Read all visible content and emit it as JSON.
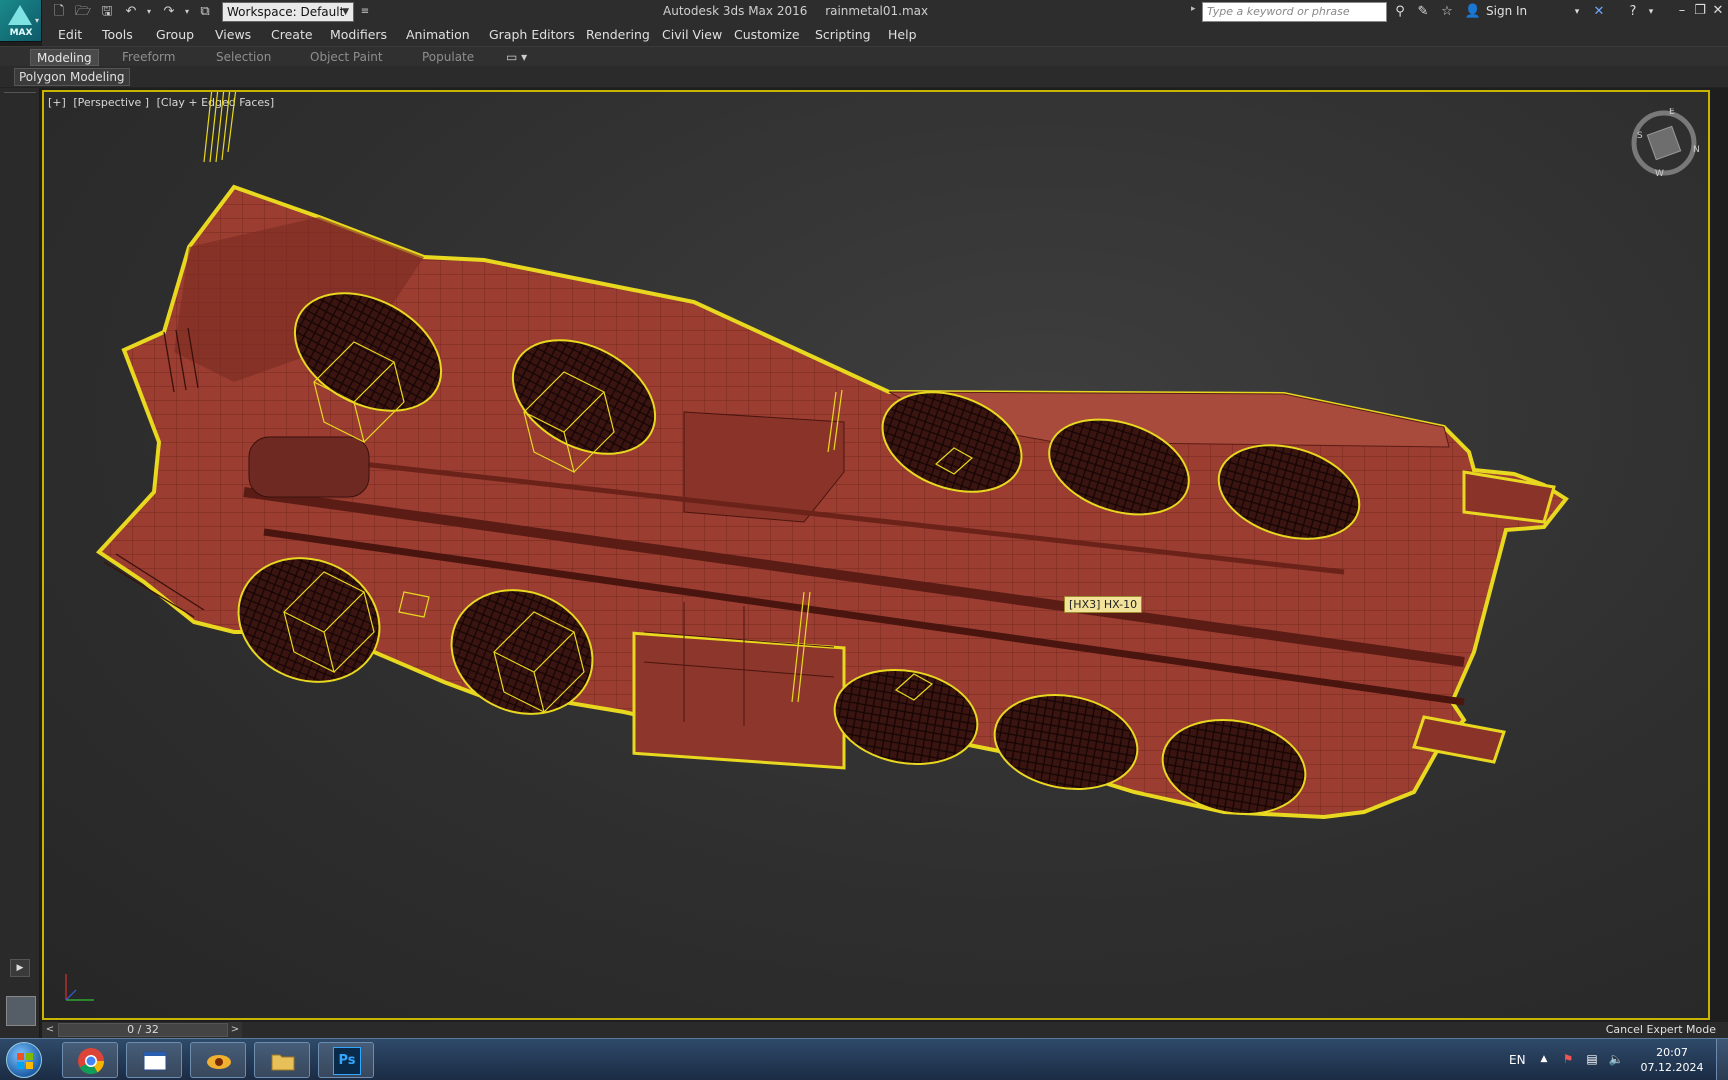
{
  "app": {
    "logo_text": "MAX",
    "workspace_label": "Workspace: Default",
    "title_app": "Autodesk 3ds Max 2016",
    "title_file": "rainmetal01.max",
    "search_placeholder": "Type a keyword or phrase",
    "sign_in": "Sign In"
  },
  "menu": [
    "Edit",
    "Tools",
    "Group",
    "Views",
    "Create",
    "Modifiers",
    "Animation",
    "Graph Editors",
    "Rendering",
    "Civil View",
    "Customize",
    "Scripting",
    "Help"
  ],
  "ribbon": {
    "tabs": [
      "Modeling",
      "Freeform",
      "Selection",
      "Object Paint",
      "Populate"
    ],
    "active_tab": "Modeling",
    "panel_button": "Polygon Modeling"
  },
  "viewport": {
    "label_parts": [
      "[+]",
      "[Perspective ]",
      "[Clay + Edged Faces]"
    ],
    "tooltip": "[HX3] HX-10",
    "highlight_color": "#e8d820",
    "model_color": "#9a3c30"
  },
  "timeline": {
    "frame": "0 / 32",
    "expert_mode": "Cancel Expert Mode"
  },
  "taskbar": {
    "language": "EN",
    "time": "20:07",
    "date": "07.12.2024",
    "ps_label": "Ps"
  }
}
